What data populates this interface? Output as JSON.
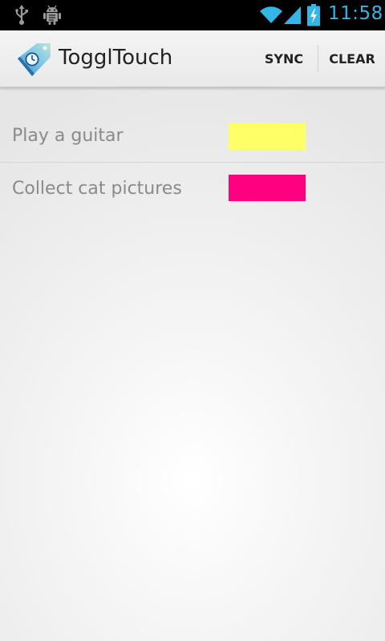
{
  "status_bar": {
    "time": "11:58",
    "icons": [
      "usb-icon",
      "android-debug-icon",
      "wifi-icon",
      "signal-icon",
      "battery-charging-icon"
    ],
    "accent_color": "#33b5e5"
  },
  "action_bar": {
    "app_icon": "toggl-clock-tag-icon",
    "title": "TogglTouch",
    "sync_label": "SYNC",
    "clear_label": "CLEAR"
  },
  "tasks": [
    {
      "name": "Play a guitar",
      "color": "#ffff66"
    },
    {
      "name": "Collect cat pictures",
      "color": "#ff0080"
    }
  ]
}
